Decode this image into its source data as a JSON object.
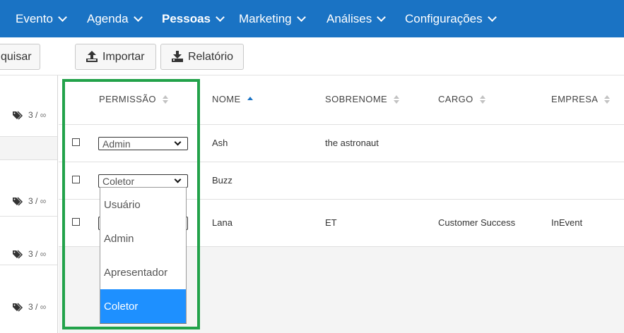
{
  "nav": {
    "items": [
      {
        "label": "Evento"
      },
      {
        "label": "Agenda"
      },
      {
        "label": "Pessoas",
        "active": true
      },
      {
        "label": "Marketing"
      },
      {
        "label": "Análises"
      },
      {
        "label": "Configurações"
      }
    ],
    "background": "#1a73c4"
  },
  "toolbar": {
    "search_label": "quisar",
    "import_label": "Importar",
    "report_label": "Relatório"
  },
  "left_panel": {
    "tags": [
      {
        "count": "3",
        "sep": "/",
        "limit": "∞"
      },
      {
        "count": "3",
        "sep": "/",
        "limit": "∞"
      },
      {
        "count": "3",
        "sep": "/",
        "limit": "∞"
      },
      {
        "count": "3",
        "sep": "/",
        "limit": "∞"
      }
    ]
  },
  "table": {
    "columns": [
      {
        "label": "PERMISSÃO",
        "sort": "none"
      },
      {
        "label": "NOME",
        "sort": "asc"
      },
      {
        "label": "SOBRENOME",
        "sort": "none"
      },
      {
        "label": "CARGO",
        "sort": "none"
      },
      {
        "label": "EMPRESA",
        "sort": "none"
      }
    ],
    "rows": [
      {
        "permission": "Admin",
        "nome": "Ash",
        "sobrenome": "the astronaut",
        "cargo": "",
        "empresa": ""
      },
      {
        "permission": "Coletor",
        "nome": "Buzz",
        "sobrenome": "",
        "cargo": "",
        "empresa": ""
      },
      {
        "permission": "",
        "nome": "Lana",
        "sobrenome": "ET",
        "cargo": "Customer Success",
        "empresa": "InEvent"
      }
    ]
  },
  "permission_dropdown": {
    "options": [
      "Usuário",
      "Admin",
      "Apresentador",
      "Coletor"
    ],
    "selected": "Coletor",
    "selected_color": "#1e90ff"
  },
  "highlight_color": "#22a24a"
}
